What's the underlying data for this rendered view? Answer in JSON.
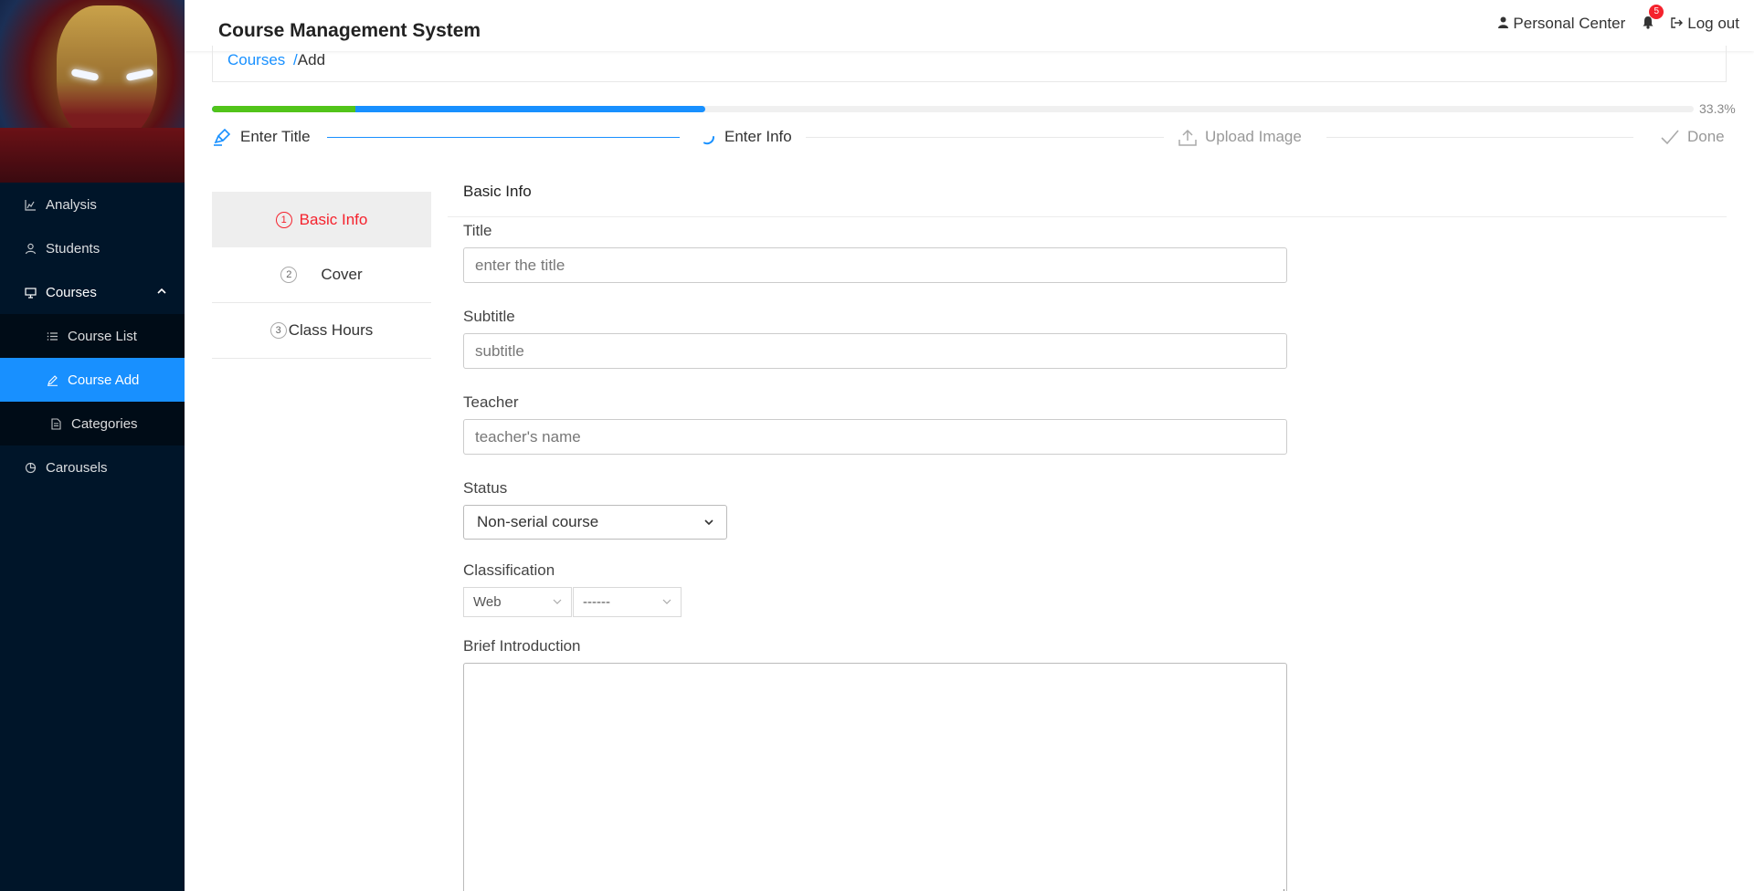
{
  "header": {
    "title": "Course Management System",
    "personal_center": "Personal Center",
    "notification_count": "5",
    "logout": "Log out"
  },
  "sidebar": {
    "items": [
      {
        "label": "Analysis",
        "icon": "chart-icon"
      },
      {
        "label": "Students",
        "icon": "user-icon"
      },
      {
        "label": "Courses",
        "icon": "monitor-icon",
        "expanded": true
      },
      {
        "label": "Carousels",
        "icon": "pie-chart-icon"
      }
    ],
    "submenu": [
      {
        "label": "Course List",
        "icon": "list-icon"
      },
      {
        "label": "Course Add",
        "icon": "edit-icon",
        "active": true
      },
      {
        "label": "Categories",
        "icon": "file-icon"
      }
    ]
  },
  "breadcrumb": {
    "link": "Courses",
    "separator": "/",
    "current": "Add"
  },
  "progress": {
    "percent_label": "33.3%",
    "success_percent": 9.7,
    "percent": 33.3
  },
  "steps": [
    {
      "label": "Enter Title",
      "status": "finish",
      "icon": "highlight-icon"
    },
    {
      "label": "Enter Info",
      "status": "process",
      "icon": "loading-icon"
    },
    {
      "label": "Upload Image",
      "status": "wait",
      "icon": "upload-icon"
    },
    {
      "label": "Done",
      "status": "wait",
      "icon": "check-icon"
    }
  ],
  "side_tabs": [
    {
      "num": "1",
      "label": "Basic Info",
      "active": true
    },
    {
      "num": "2",
      "label": "Cover"
    },
    {
      "num": "3",
      "label": "Class Hours"
    }
  ],
  "form": {
    "section_title": "Basic Info",
    "title_label": "Title",
    "title_placeholder": "enter the title",
    "subtitle_label": "Subtitle",
    "subtitle_placeholder": "subtitle",
    "teacher_label": "Teacher",
    "teacher_placeholder": "teacher's name",
    "status_label": "Status",
    "status_value": "Non-serial course",
    "classification_label": "Classification",
    "classification_primary": "Web",
    "classification_secondary": "------",
    "intro_label": "Brief Introduction"
  },
  "colors": {
    "sidebar_bg": "#001529",
    "submenu_bg": "#000c17",
    "accent": "#1890ff",
    "success": "#52c41a",
    "danger": "#f5222d"
  }
}
